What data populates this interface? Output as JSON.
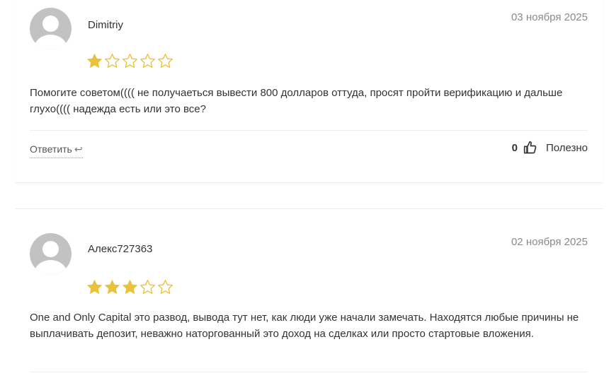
{
  "colors": {
    "star_filled": "#e8c33b",
    "star_empty_outline": "#e8c33b",
    "avatar_bg": "#c2c2c2",
    "date_text": "#8a8a8a"
  },
  "reviews": [
    {
      "author": "Dimitriy",
      "date": "03 ноября 2025",
      "rating": 1,
      "rating_max": 5,
      "text": "Помогите советом(((( не получаеться вывести 800 долларов оттуда, просят пройти верификацию и дальше глухо(((( надежда есть или это все?",
      "reply_label": "Ответить",
      "reply_icon": "reply-arrow-icon",
      "helpful_count": "0",
      "helpful_icon": "thumbs-up-icon",
      "helpful_label": "Полезно"
    },
    {
      "author": "Алекс727363",
      "date": "02 ноября 2025",
      "rating": 3,
      "rating_max": 5,
      "text": "One and Only Capital это развод, вывода тут нет, как люди уже начали замечать. Находятся любые причины не выплачивать депозит, неважно наторгованный это доход на сделках или просто стартовые вложения."
    }
  ]
}
